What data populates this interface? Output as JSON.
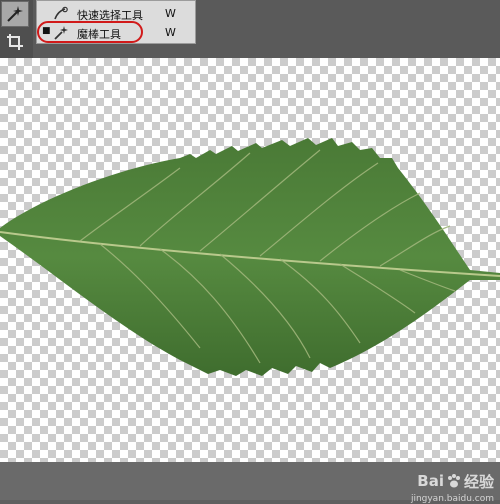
{
  "tools_flyout": {
    "items": [
      {
        "label": "快速选择工具",
        "shortcut": "W",
        "icon": "quick-selection-icon",
        "active": false
      },
      {
        "label": "魔棒工具",
        "shortcut": "W",
        "icon": "magic-wand-icon",
        "active": true
      }
    ],
    "active_marker": "■"
  },
  "toolbar": {
    "tools": [
      "magic-wand-icon",
      "crop-icon"
    ]
  },
  "watermark": {
    "brand_left": "Bai",
    "brand_right": "经验",
    "site": "jingyan.baidu.com"
  },
  "colors": {
    "highlight": "#d11a1a",
    "leaf": "#4f7f3a"
  }
}
